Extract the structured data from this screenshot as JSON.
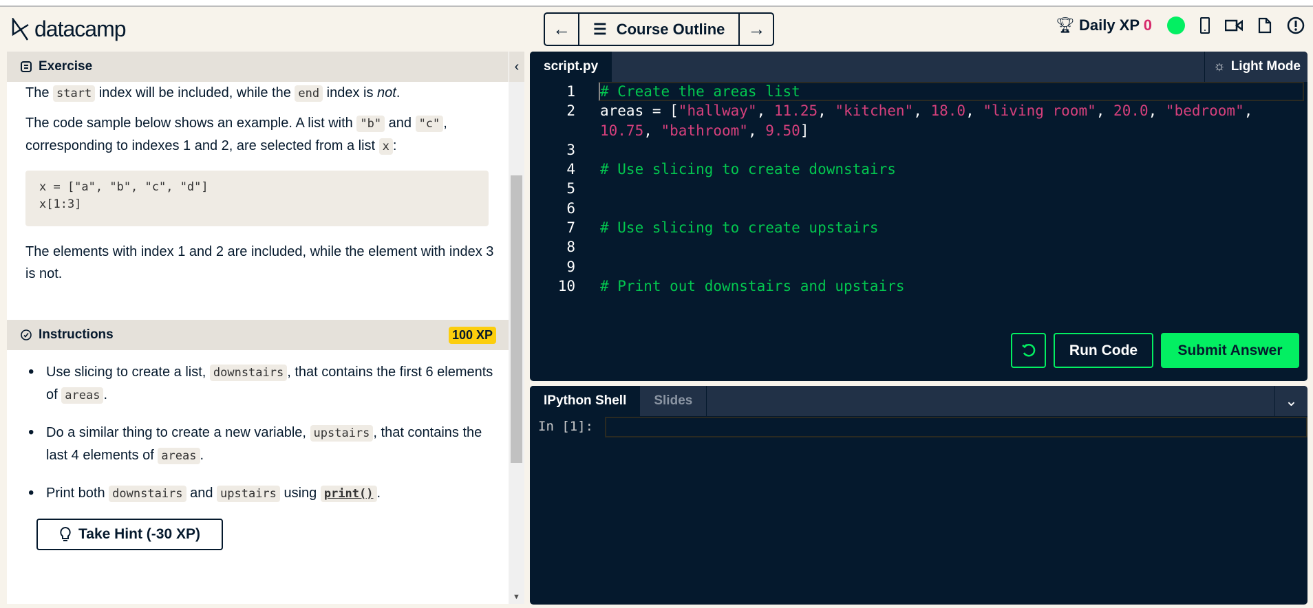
{
  "header": {
    "logo": "datacamp",
    "prev_label": "←",
    "outline_label": "Course Outline",
    "next_label": "→",
    "daily_xp_label": "Daily XP",
    "daily_xp_value": "0"
  },
  "exercise": {
    "title": "Exercise",
    "collapse": "‹",
    "p0": [
      "The ",
      "start",
      " index will be included, while the ",
      "end",
      " index is ",
      "not",
      "."
    ],
    "p1": [
      "The code sample below shows an example. A list with ",
      "\"b\"",
      " and ",
      "\"c\"",
      ", corresponding to indexes 1 and 2, are selected from a list ",
      "x",
      ":"
    ],
    "code_sample": "x = [\"a\", \"b\", \"c\", \"d\"]\nx[1:3]",
    "p2": "The elements with index 1 and 2 are included, while the element with index 3 is not."
  },
  "instructions": {
    "title": "Instructions",
    "xp": "100 XP",
    "items": [
      [
        "Use slicing to create a list, ",
        "downstairs",
        ", that contains the first 6 elements of ",
        "areas",
        "."
      ],
      [
        "Do a similar thing to create a new variable, ",
        "upstairs",
        ", that contains the last 4 elements of ",
        "areas",
        "."
      ],
      [
        "Print both ",
        "downstairs",
        " and ",
        "upstairs",
        " using ",
        "print()",
        "."
      ]
    ],
    "hint_label": "Take Hint (-30 XP)"
  },
  "editor": {
    "tab": "script.py",
    "light_mode": "Light Mode",
    "line_numbers": [
      "1",
      "2",
      "",
      "3",
      "4",
      "5",
      "6",
      "7",
      "8",
      "9",
      "10"
    ],
    "line1": "# Create the areas list",
    "line2": [
      "areas = [",
      "\"hallway\"",
      ", ",
      "11.25",
      ", ",
      "\"kitchen\"",
      ", ",
      "18.0",
      ", ",
      "\"living room\"",
      ", ",
      "20.0",
      ", ",
      "\"bedroom\"",
      ","
    ],
    "line2b": [
      "10.75",
      ", ",
      "\"bathroom\"",
      ", ",
      "9.50",
      "]"
    ],
    "line4": "# Use slicing to create downstairs",
    "line7": "# Use slicing to create upstairs",
    "line10": "# Print out downstairs and upstairs",
    "run_label": "Run Code",
    "submit_label": "Submit Answer"
  },
  "shell": {
    "tab_shell": "IPython Shell",
    "tab_slides": "Slides",
    "prompt": "In [1]:",
    "input": ""
  },
  "colors": {
    "accent": "#03ef62",
    "navy": "#05192d",
    "xp_badge": "#fcce0d",
    "string": "#d6407c",
    "comment": "#03c74f"
  }
}
